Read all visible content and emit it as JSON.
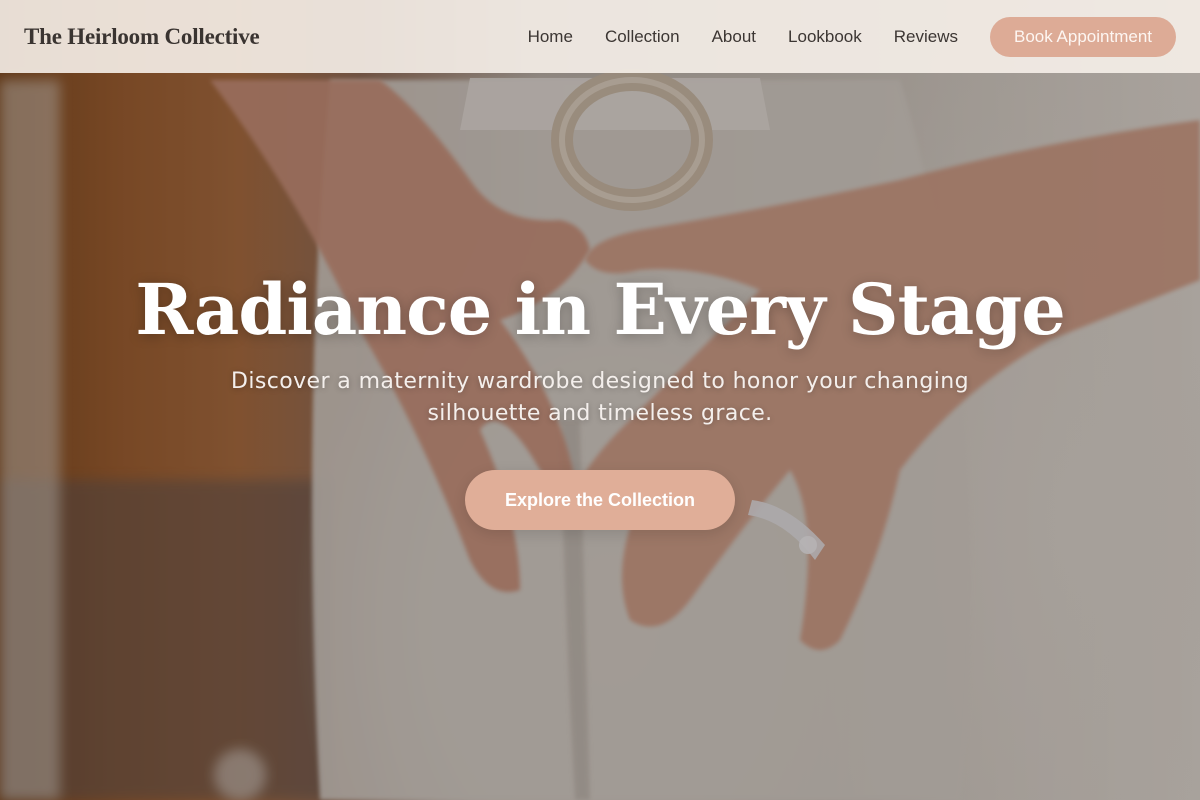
{
  "header": {
    "brand": "The Heirloom Collective",
    "nav": [
      "Home",
      "Collection",
      "About",
      "Lookbook",
      "Reviews"
    ],
    "cta_label": "Book Appointment"
  },
  "hero": {
    "title": "Radiance in Every Stage",
    "subtitle": "Discover a maternity wardrobe designed to honor your changing silhouette and timeless grace.",
    "cta_label": "Explore the Collection"
  },
  "colors": {
    "accent": "#ddab96",
    "header_bg": "#f6efe9",
    "brand_text": "#3a3431",
    "hero_text": "#ffffff"
  }
}
